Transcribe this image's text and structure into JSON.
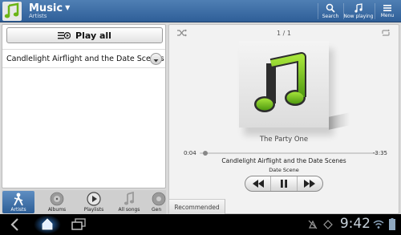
{
  "actionbar": {
    "title": "Music",
    "subtitle": "Artists",
    "buttons": [
      {
        "label": "Search",
        "icon": "search-icon"
      },
      {
        "label": "Now playing",
        "icon": "now-playing-icon"
      },
      {
        "label": "Menu",
        "icon": "menu-icon"
      }
    ]
  },
  "left": {
    "play_all_label": "Play all",
    "track_name": "Candlelight Airflight and the Date Scenes"
  },
  "tabs": [
    {
      "label": "Artists",
      "icon": "artist-icon",
      "active": true
    },
    {
      "label": "Albums",
      "icon": "album-icon",
      "active": false
    },
    {
      "label": "Playlists",
      "icon": "playlist-icon",
      "active": false
    },
    {
      "label": "All songs",
      "icon": "music-note-icon",
      "active": false
    },
    {
      "label": "Gen",
      "icon": "genre-icon",
      "active": false
    }
  ],
  "player": {
    "queue_position": "1 / 1",
    "album_caption": "The Party One",
    "elapsed": "0:04",
    "remaining": "-3:35",
    "progress_fraction": 0.02,
    "song": "Candlelight Airflight and the Date Scenes",
    "artist": "Date Scene",
    "recommended_label": "Recommended"
  },
  "system": {
    "time": "9:42"
  },
  "colors": {
    "accent": "#3a6aa5",
    "note_green": "#7cc81a"
  }
}
